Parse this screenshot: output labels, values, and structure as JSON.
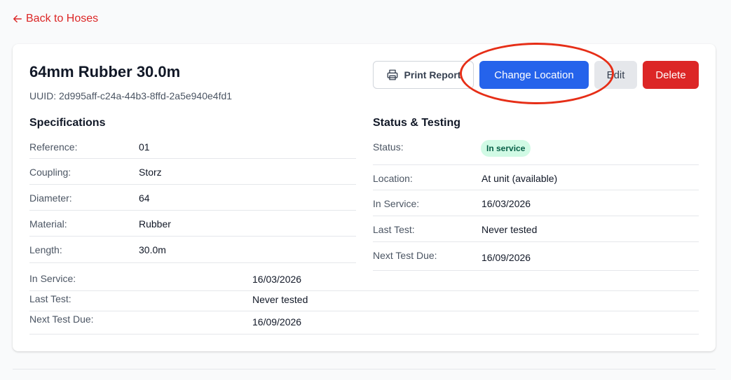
{
  "nav": {
    "back_label": "Back to Hoses"
  },
  "hose": {
    "title": "64mm Rubber 30.0m",
    "uuid": "UUID: 2d995aff-c24a-44b3-8ffd-2a5e940e4fd1"
  },
  "actions": {
    "print": "Print Report",
    "change_location": "Change Location",
    "edit": "Edit",
    "delete": "Delete"
  },
  "specifications": {
    "title": "Specifications",
    "rows": [
      {
        "label": "Reference:",
        "value": "01"
      },
      {
        "label": "Coupling:",
        "value": "Storz"
      },
      {
        "label": "Diameter:",
        "value": "64"
      },
      {
        "label": "Material:",
        "value": "Rubber"
      },
      {
        "label": "Length:",
        "value": "30.0m"
      }
    ],
    "dates": [
      {
        "label": "In Service:",
        "value": "16/03/2026"
      },
      {
        "label": "Last Test:",
        "value": "Never tested"
      },
      {
        "label": "Next Test Due:",
        "value": "16/09/2026"
      }
    ]
  },
  "status": {
    "title": "Status & Testing",
    "status_label": "Status:",
    "status_badge": "In service",
    "rows": [
      {
        "label": "Location:",
        "value": "At unit (available)"
      },
      {
        "label": "In Service:",
        "value": "16/03/2026"
      },
      {
        "label": "Last Test:",
        "value": "Never tested"
      },
      {
        "label": "Next Test Due:",
        "value": "16/09/2026"
      }
    ]
  },
  "colors": {
    "link": "#dc2626",
    "primary": "#2563eb",
    "danger": "#dc2626",
    "badge_bg": "#d1fae5",
    "badge_text": "#065f46",
    "annotation": "#e62e17"
  },
  "icons": {
    "back": "arrow-left-icon",
    "print": "printer-icon"
  }
}
